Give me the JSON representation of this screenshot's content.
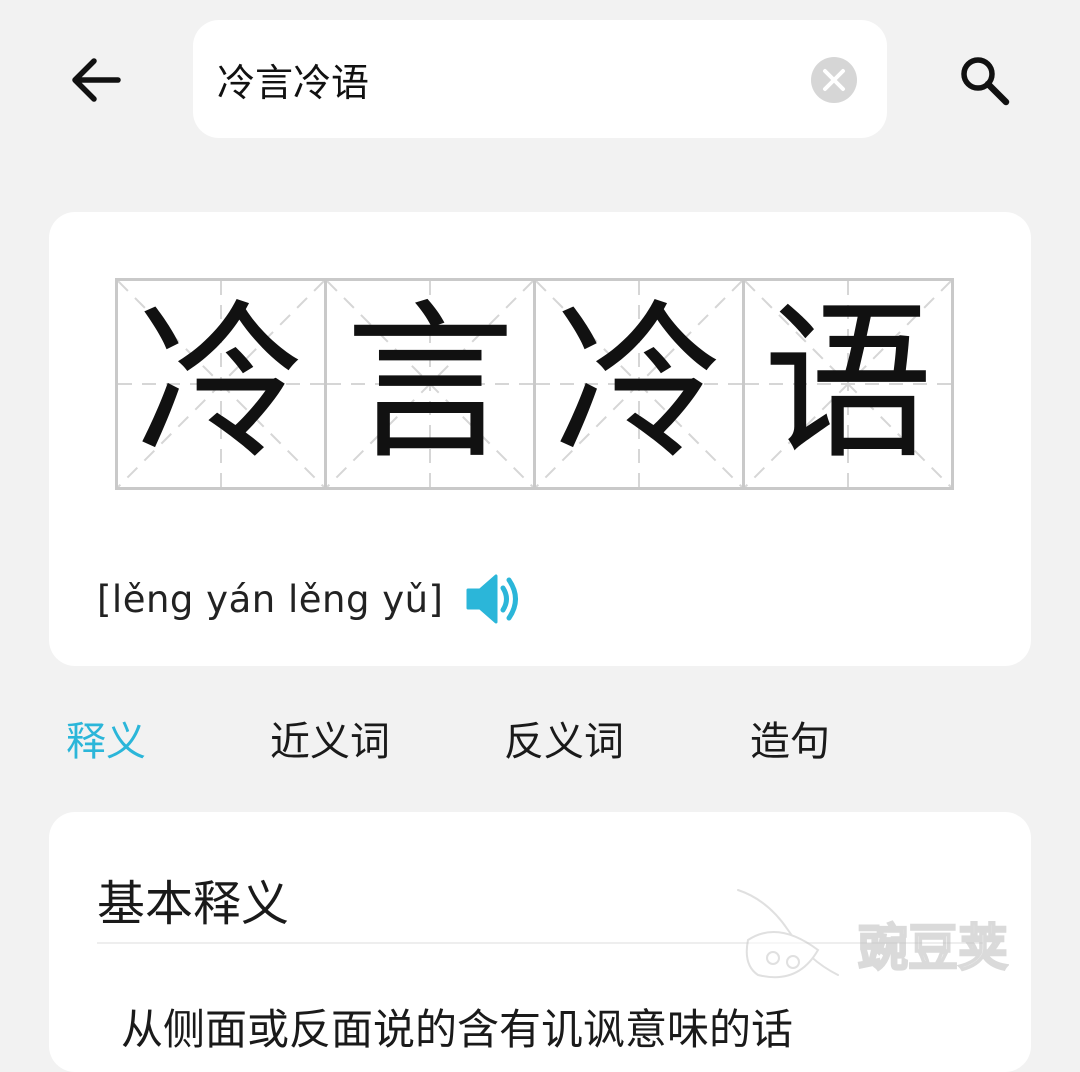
{
  "search": {
    "query": "冷言冷语"
  },
  "word": {
    "characters": [
      "冷",
      "言",
      "冷",
      "语"
    ],
    "pinyin": "[lěng yán lěng yǔ]"
  },
  "tabs": [
    {
      "label": "释义",
      "active": true
    },
    {
      "label": "近义词",
      "active": false
    },
    {
      "label": "反义词",
      "active": false
    },
    {
      "label": "造句",
      "active": false
    }
  ],
  "definition": {
    "heading": "基本释义",
    "text": "从侧面或反面说的含有讥讽意味的话"
  },
  "watermark": {
    "text": "豌豆荚"
  },
  "colors": {
    "accent": "#2bb6d9",
    "background": "#f2f2f2",
    "card": "#ffffff"
  },
  "icons": {
    "back": "arrow-left-icon",
    "clear": "clear-circle-icon",
    "search": "search-icon",
    "speaker": "speaker-icon"
  }
}
